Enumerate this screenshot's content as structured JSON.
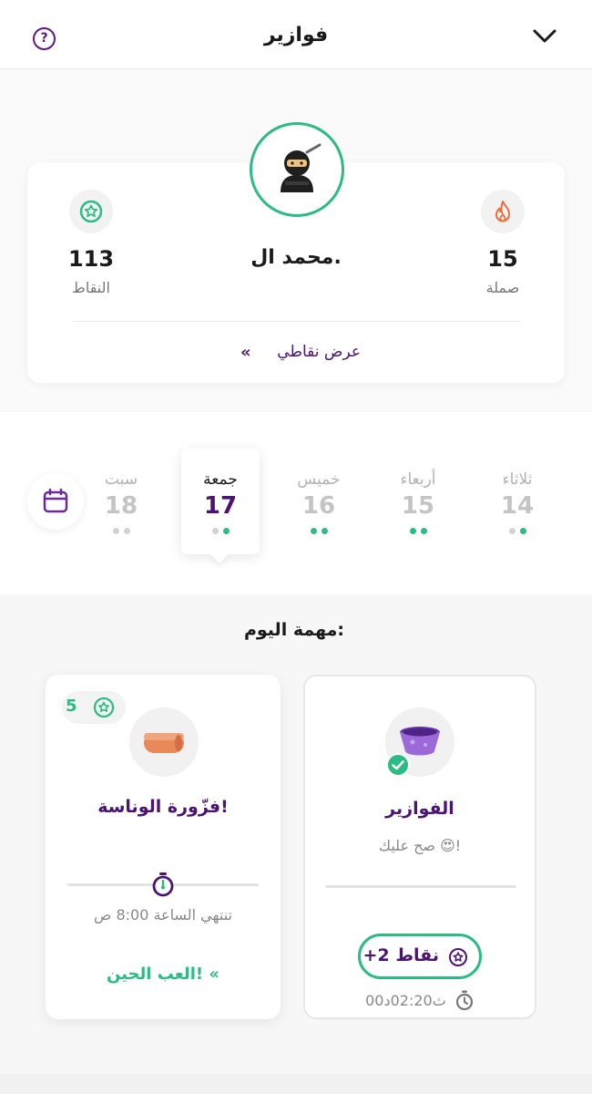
{
  "header": {
    "title": "فوازير",
    "help_label": "?"
  },
  "profile": {
    "name": "محمد ال.",
    "points_value": "113",
    "points_label": "النقاط",
    "streak_value": "15",
    "streak_label": "صملة",
    "view_points_link": "عرض نقاطي",
    "view_points_arrows": "«"
  },
  "days": [
    {
      "name": "ثلاثاء",
      "num": "14",
      "dots": [
        false,
        true
      ]
    },
    {
      "name": "أربعاء",
      "num": "15",
      "dots": [
        true,
        true
      ]
    },
    {
      "name": "خميس",
      "num": "16",
      "dots": [
        true,
        true
      ]
    },
    {
      "name": "جمعة",
      "num": "17",
      "dots": [
        false,
        true
      ],
      "active": true
    },
    {
      "name": "سبت",
      "num": "18",
      "dots": [
        false,
        false
      ]
    }
  ],
  "section": {
    "title": "مهمة اليوم:"
  },
  "tasks": {
    "left": {
      "reward": "5",
      "title": "فزّورة الوناسة!",
      "expires_label": "تنتهي  الساعة 8:00 ص",
      "play_label": "العب الحين!",
      "play_arrows": "«"
    },
    "right": {
      "title": "الفوازير",
      "subtitle": "صح عليك 😍!",
      "points_label": "+2  نقاط",
      "elapsed": "ث02:20د00"
    }
  },
  "colors": {
    "accent_green": "#2dbb84",
    "brand_purple": "#4a1572",
    "streak_orange": "#f26b3a"
  }
}
